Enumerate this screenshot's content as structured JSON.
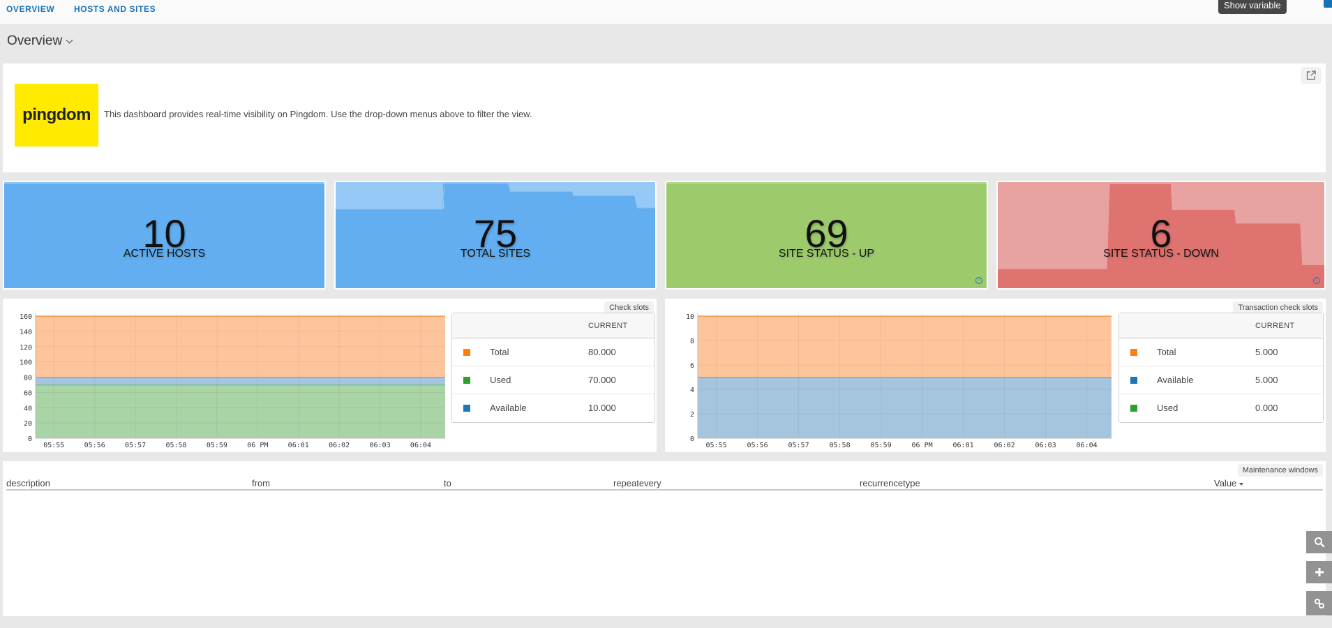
{
  "nav": {
    "tabs": [
      {
        "label": "OVERVIEW"
      },
      {
        "label": "HOSTS AND SITES"
      }
    ],
    "tooltip": "Show variable"
  },
  "dashboard": {
    "title": "Overview"
  },
  "info_panel": {
    "logo_text": "pingdom",
    "description": "This dashboard provides real-time visibility on Pingdom. Use the drop-down menus above to filter the view."
  },
  "stats": [
    {
      "value": "10",
      "label": "ACTIVE HOSTS",
      "color": "#62aef0"
    },
    {
      "value": "75",
      "label": "TOTAL SITES",
      "color": "#62aef0"
    },
    {
      "value": "69",
      "label": "SITE STATUS - UP",
      "color": "#9dcb6c"
    },
    {
      "value": "6",
      "label": "SITE STATUS - DOWN",
      "color": "#e8a3a1"
    }
  ],
  "chart_data": [
    {
      "type": "area",
      "title": "Check slots",
      "stacked": true,
      "x": [
        "05:55",
        "05:56",
        "05:57",
        "05:58",
        "05:59",
        "06 PM",
        "06:01",
        "06:02",
        "06:03",
        "06:04"
      ],
      "ylim": [
        0,
        160
      ],
      "yticks": [
        0,
        20,
        40,
        60,
        80,
        100,
        120,
        140,
        160
      ],
      "grid": true,
      "stack_order": [
        "Used",
        "Available",
        "Total"
      ],
      "series": [
        {
          "name": "Total",
          "color": "#ff7f0e",
          "values": [
            80,
            80,
            80,
            80,
            80,
            80,
            80,
            80,
            80,
            80
          ]
        },
        {
          "name": "Used",
          "color": "#2ca02c",
          "values": [
            70,
            70,
            70,
            70,
            70,
            70,
            70,
            70,
            70,
            70
          ]
        },
        {
          "name": "Available",
          "color": "#1f77b4",
          "values": [
            10,
            10,
            10,
            10,
            10,
            10,
            10,
            10,
            10,
            10
          ]
        }
      ],
      "legend": {
        "header": "CURRENT",
        "rows": [
          {
            "name": "Total",
            "value": "80.000",
            "color": "#ff7f0e"
          },
          {
            "name": "Used",
            "value": "70.000",
            "color": "#2ca02c"
          },
          {
            "name": "Available",
            "value": "10.000",
            "color": "#1f77b4"
          }
        ]
      }
    },
    {
      "type": "area",
      "title": "Transaction check slots",
      "stacked": true,
      "x": [
        "05:55",
        "05:56",
        "05:57",
        "05:58",
        "05:59",
        "06 PM",
        "06:01",
        "06:02",
        "06:03",
        "06:04"
      ],
      "ylim": [
        0,
        10
      ],
      "yticks": [
        0,
        2,
        4,
        6,
        8,
        10
      ],
      "grid": true,
      "stack_order": [
        "Available",
        "Used",
        "Total"
      ],
      "series": [
        {
          "name": "Total",
          "color": "#ff7f0e",
          "values": [
            5,
            5,
            5,
            5,
            5,
            5,
            5,
            5,
            5,
            5
          ]
        },
        {
          "name": "Available",
          "color": "#1f77b4",
          "values": [
            5,
            5,
            5,
            5,
            5,
            5,
            5,
            5,
            5,
            5
          ]
        },
        {
          "name": "Used",
          "color": "#2ca02c",
          "values": [
            0,
            0,
            0,
            0,
            0,
            0,
            0,
            0,
            0,
            0
          ]
        }
      ],
      "legend": {
        "header": "CURRENT",
        "rows": [
          {
            "name": "Total",
            "value": "5.000",
            "color": "#ff7f0e"
          },
          {
            "name": "Available",
            "value": "5.000",
            "color": "#1f77b4"
          },
          {
            "name": "Used",
            "value": "0.000",
            "color": "#2ca02c"
          }
        ]
      }
    }
  ],
  "maintenance": {
    "title": "Maintenance windows",
    "columns": [
      "description",
      "from",
      "to",
      "repeatevery",
      "recurrencetype",
      "Value"
    ],
    "sort_column": "Value",
    "rows": []
  },
  "side_buttons": [
    {
      "icon": "search-icon"
    },
    {
      "icon": "plus-icon"
    },
    {
      "icon": "link-icon"
    }
  ]
}
